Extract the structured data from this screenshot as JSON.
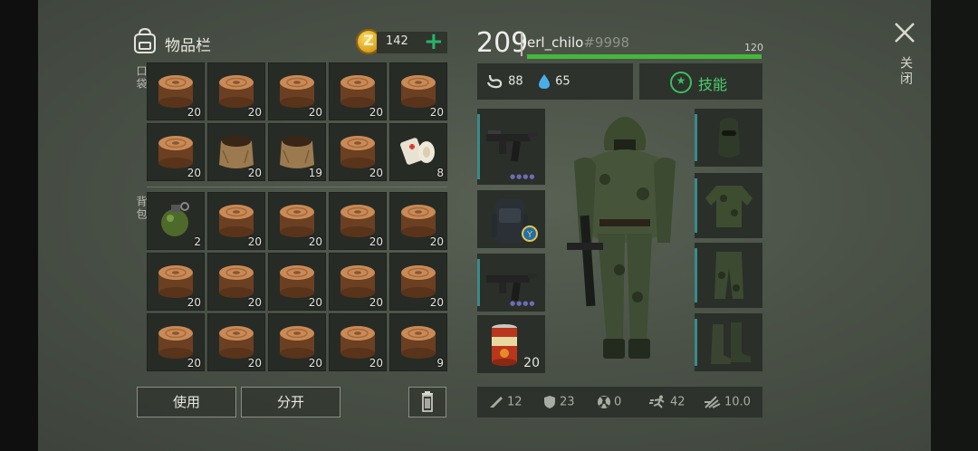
{
  "inventory": {
    "title": "物品栏",
    "coins": "142",
    "pocket_label": "口袋",
    "backpack_label": "背包",
    "pocket": [
      {
        "item": "log",
        "qty": "20"
      },
      {
        "item": "log",
        "qty": "20"
      },
      {
        "item": "log",
        "qty": "20"
      },
      {
        "item": "log",
        "qty": "20"
      },
      {
        "item": "log",
        "qty": "20"
      },
      {
        "item": "log",
        "qty": "20"
      },
      {
        "item": "sack",
        "qty": "20"
      },
      {
        "item": "sack",
        "qty": "19"
      },
      {
        "item": "log",
        "qty": "20"
      },
      {
        "item": "bandage",
        "qty": "8"
      }
    ],
    "backpack": [
      {
        "item": "grenade",
        "qty": "2"
      },
      {
        "item": "log",
        "qty": "20"
      },
      {
        "item": "log",
        "qty": "20"
      },
      {
        "item": "log",
        "qty": "20"
      },
      {
        "item": "log",
        "qty": "20"
      },
      {
        "item": "log",
        "qty": "20"
      },
      {
        "item": "log",
        "qty": "20"
      },
      {
        "item": "log",
        "qty": "20"
      },
      {
        "item": "log",
        "qty": "20"
      },
      {
        "item": "log",
        "qty": "20"
      },
      {
        "item": "log",
        "qty": "20"
      },
      {
        "item": "log",
        "qty": "20"
      },
      {
        "item": "log",
        "qty": "20"
      },
      {
        "item": "log",
        "qty": "20"
      },
      {
        "item": "log",
        "qty": "9"
      }
    ],
    "use_label": "使用",
    "split_label": "分开"
  },
  "player": {
    "level": "209",
    "name": "erl_chilo",
    "tag": "#9998",
    "hp_max": "120",
    "hp_fraction": 1.0,
    "hunger": "88",
    "thirst": "65",
    "skills_label": "技能"
  },
  "equipment": {
    "weapon1": "smg-icon",
    "backpack": "backpack-icon",
    "weapon2": "smg-icon",
    "food_qty": "20",
    "head": "balaclava-icon",
    "body": "ghillie-jacket-icon",
    "legs": "camo-pants-icon",
    "feet": "boots-icon"
  },
  "stats": {
    "attack": "12",
    "defense": "23",
    "radiation": "0",
    "speed": "42",
    "stealth": "10.0"
  },
  "close_label": "关闭",
  "colors": {
    "accent_green": "#45b83a",
    "coin_gold": "#d59a15",
    "skills_green": "#49cf6c"
  }
}
